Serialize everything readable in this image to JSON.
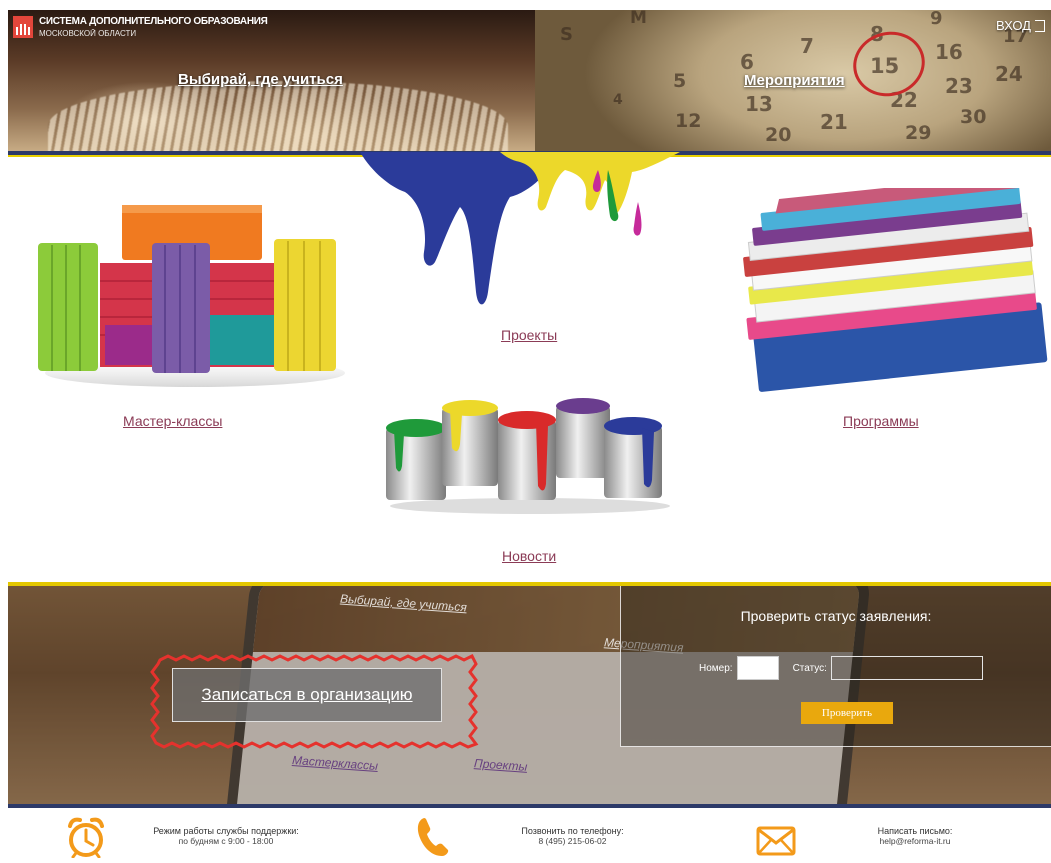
{
  "logo": {
    "title": "СИСТЕМА ДОПОЛНИТЕЛЬНОГО ОБРАЗОВАНИЯ",
    "subtitle": "МОСКОВСКОЙ ОБЛАСТИ",
    "accent": "#e3463b"
  },
  "header": {
    "choose_link": "Выбирай, где учиться",
    "events_link": "Мероприятия",
    "login_label": "вход"
  },
  "calendar_numbers": [
    "S",
    "M",
    "5",
    "6",
    "7",
    "8",
    "9",
    "15",
    "16",
    "17",
    "24",
    "13",
    "22",
    "23",
    "12",
    "20",
    "21",
    "29",
    "30",
    "4"
  ],
  "tiles": {
    "master_classes": "Мастер-классы",
    "projects": "Проекты",
    "programs": "Программы",
    "news": "Новости"
  },
  "banner": {
    "ghost_choose": "Выбирай, где учиться",
    "ghost_events": "Мероприятия",
    "ghost_master": "Мастерклассы",
    "ghost_projects": "Проекты",
    "enroll_label": "Записаться в организацию"
  },
  "status": {
    "title": "Проверить статус заявления:",
    "number_label": "Номер:",
    "status_label": "Статус:",
    "number_value": "",
    "status_value": "",
    "check_button": "Проверить"
  },
  "footer": {
    "hours_title": "Режим работы службы поддержки:",
    "hours_value": "по будням с 9:00 - 18:00",
    "phone_title": "Позвонить по телефону:",
    "phone_value": "8 (495) 215-06-02",
    "mail_title": "Написать письмо:",
    "mail_value": "help@reforma-it.ru"
  },
  "colors": {
    "navy": "#2c3968",
    "yellow": "#e3c700",
    "link": "#8b3b56",
    "orange": "#f39a1a",
    "button": "#e9a80d"
  }
}
